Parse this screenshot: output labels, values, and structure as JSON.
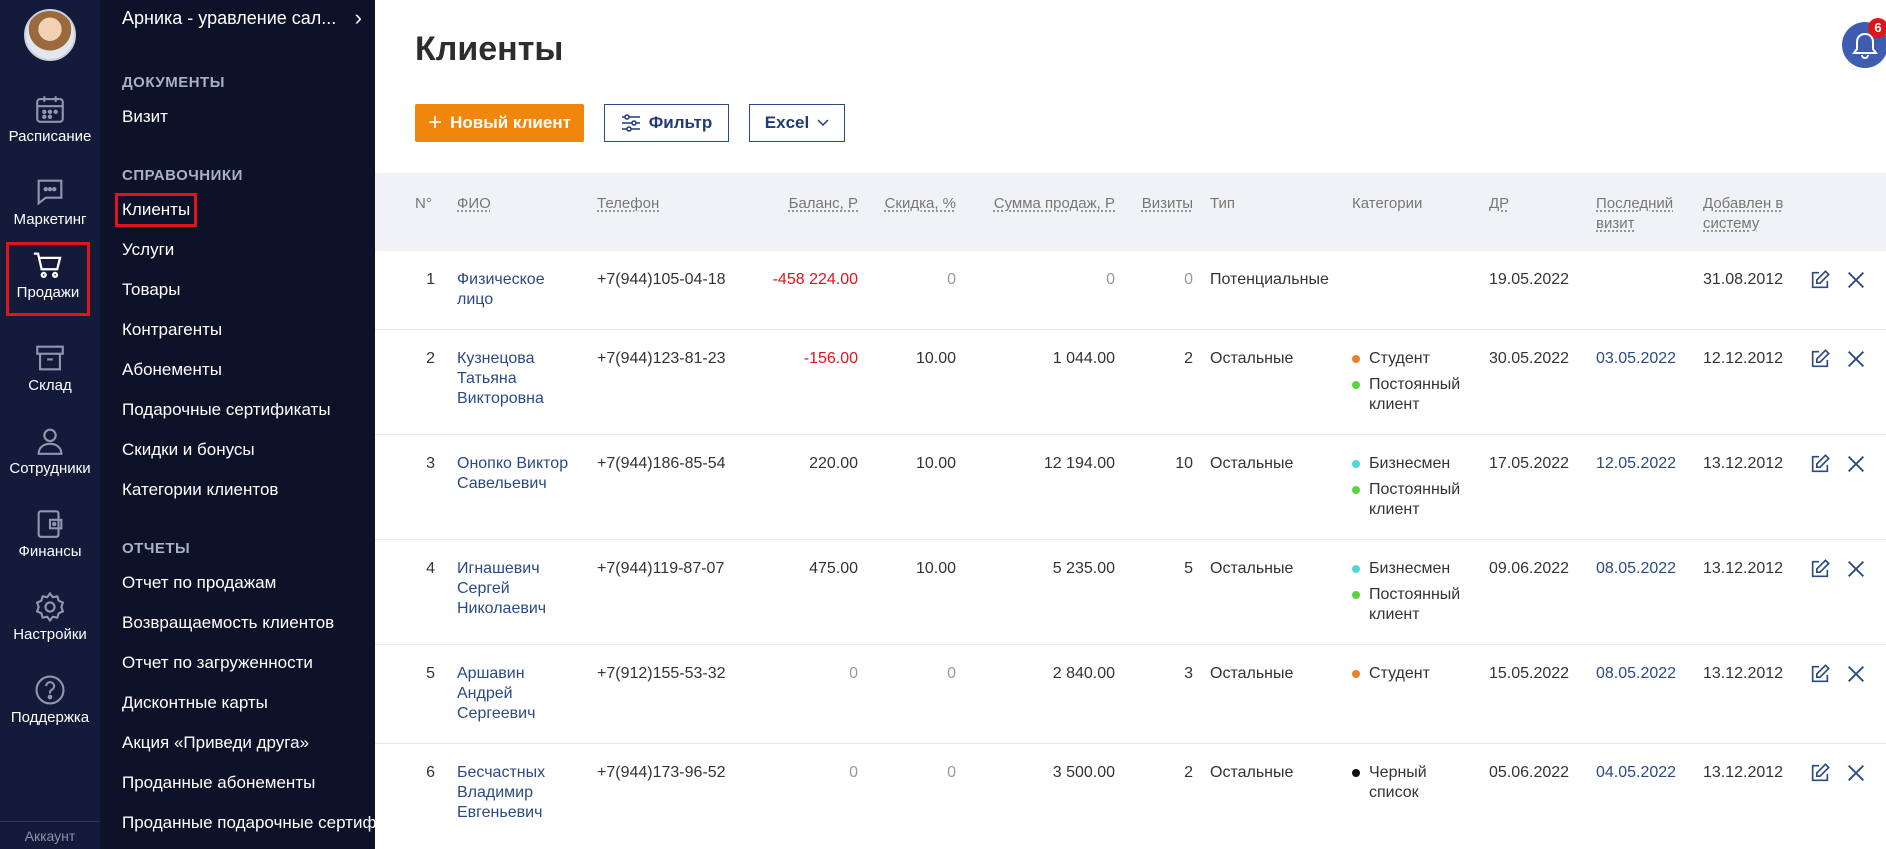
{
  "rail": {
    "items": [
      {
        "label": "Расписание",
        "icon": "calendar-icon"
      },
      {
        "label": "Маркетинг",
        "icon": "chat-icon"
      },
      {
        "label": "Продажи",
        "icon": "cart-icon",
        "active": true
      },
      {
        "label": "Склад",
        "icon": "archive-box-icon"
      },
      {
        "label": "Сотрудники",
        "icon": "person-icon"
      },
      {
        "label": "Финансы",
        "icon": "wallet-icon"
      },
      {
        "label": "Настройки",
        "icon": "gear-icon"
      },
      {
        "label": "Поддержка",
        "icon": "help-circle-icon"
      }
    ],
    "footer": "Аккаунт"
  },
  "menu": {
    "top": "Арника - уравление сал...",
    "sections": [
      {
        "title": "ДОКУМЕНТЫ",
        "items": [
          "Визит"
        ]
      },
      {
        "title": "СПРАВОЧНИКИ",
        "items": [
          "Клиенты",
          "Услуги",
          "Товары",
          "Контрагенты",
          "Абонементы",
          "Подарочные сертификаты",
          "Скидки и бонусы",
          "Категории клиентов"
        ]
      },
      {
        "title": "ОТЧЕТЫ",
        "items": [
          "Отчет по продажам",
          "Возвращаемость клиентов",
          "Отчет по загруженности",
          "Дисконтные карты",
          "Акция «Приведи друга»",
          "Проданные абонементы",
          "Проданные подарочные сертификаты"
        ]
      }
    ],
    "active_item": "Клиенты"
  },
  "page": {
    "title": "Клиенты",
    "new_client_label": "Новый клиент",
    "filter_label": "Фильтр",
    "excel_label": "Excel",
    "notifications_count": "6"
  },
  "colors": {
    "accent_orange": "#f0860c",
    "link_blue": "#2a4a86",
    "negative_red": "#e0141b",
    "sidebar_dark": "#0d1228"
  },
  "table": {
    "headers": {
      "num": "N°",
      "fio": "ФИО",
      "phone": "Телефон",
      "balance": "Баланс, Р",
      "discount": "Скидка, %",
      "sales": "Сумма продаж, Р",
      "visits": "Визиты",
      "type": "Тип",
      "categories": "Категории",
      "birthday": "ДР",
      "last_visit": "Последний визит",
      "added": "Добавлен в систему"
    },
    "rows": [
      {
        "num": "1",
        "fio": "Физическое лицо",
        "phone": "+7(944)105-04-18",
        "balance": "-458 224.00",
        "discount": "0",
        "sales": "0",
        "visits": "0",
        "type": "Потенциальные",
        "categories": [],
        "birthday": "19.05.2022",
        "last_visit": "",
        "added": "31.08.2012"
      },
      {
        "num": "2",
        "fio": "Кузнецова Татьяна Викторовна",
        "phone": "+7(944)123-81-23",
        "balance": "-156.00",
        "discount": "10.00",
        "sales": "1 044.00",
        "visits": "2",
        "type": "Остальные",
        "categories": [
          {
            "name": "Студент",
            "color": "#e8822a"
          },
          {
            "name": "Постоянный клиент",
            "color": "#5ad43a"
          }
        ],
        "birthday": "30.05.2022",
        "last_visit": "03.05.2022",
        "added": "12.12.2012"
      },
      {
        "num": "3",
        "fio": "Онопко Виктор Савельевич",
        "phone": "+7(944)186-85-54",
        "balance": "220.00",
        "discount": "10.00",
        "sales": "12 194.00",
        "visits": "10",
        "type": "Остальные",
        "categories": [
          {
            "name": "Бизнесмен",
            "color": "#4fd8d8"
          },
          {
            "name": "Постоянный клиент",
            "color": "#5ad43a"
          }
        ],
        "birthday": "17.05.2022",
        "last_visit": "12.05.2022",
        "added": "13.12.2012"
      },
      {
        "num": "4",
        "fio": "Игнашевич Сергей Николаевич",
        "phone": "+7(944)119-87-07",
        "balance": "475.00",
        "discount": "10.00",
        "sales": "5 235.00",
        "visits": "5",
        "type": "Остальные",
        "categories": [
          {
            "name": "Бизнесмен",
            "color": "#4fd8d8"
          },
          {
            "name": "Постоянный клиент",
            "color": "#5ad43a"
          }
        ],
        "birthday": "09.06.2022",
        "last_visit": "08.05.2022",
        "added": "13.12.2012"
      },
      {
        "num": "5",
        "fio": "Аршавин Андрей Сергеевич",
        "phone": "+7(912)155-53-32",
        "balance": "0",
        "discount": "0",
        "sales": "2 840.00",
        "visits": "3",
        "type": "Остальные",
        "categories": [
          {
            "name": "Студент",
            "color": "#e8822a"
          }
        ],
        "birthday": "15.05.2022",
        "last_visit": "08.05.2022",
        "added": "13.12.2012"
      },
      {
        "num": "6",
        "fio": "Бесчастных Владимир Евгеньевич",
        "phone": "+7(944)173-96-52",
        "balance": "0",
        "discount": "0",
        "sales": "3 500.00",
        "visits": "2",
        "type": "Остальные",
        "categories": [
          {
            "name": "Черный список",
            "color": "#111111"
          }
        ],
        "birthday": "05.06.2022",
        "last_visit": "04.05.2022",
        "added": "13.12.2012"
      }
    ]
  }
}
